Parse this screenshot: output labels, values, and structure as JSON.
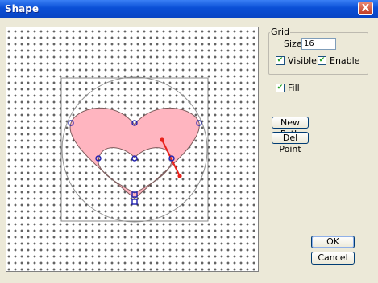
{
  "window": {
    "title": "Shape",
    "close_glyph": "X"
  },
  "canvas": {
    "heart_fill": "#ffb5c0",
    "handle_color": "#e8221c",
    "node_color": "#2020b0"
  },
  "grid_group": {
    "legend": "Grid",
    "size_label": "Size:",
    "size_value": "16",
    "visible_label": "Visible",
    "visible_checked": true,
    "enable_label": "Enable",
    "enable_checked": true
  },
  "fill": {
    "label": "Fill",
    "checked": true
  },
  "buttons": {
    "new_path": "New Path",
    "del_point": "Del Point",
    "ok": "OK",
    "cancel": "Cancel"
  }
}
